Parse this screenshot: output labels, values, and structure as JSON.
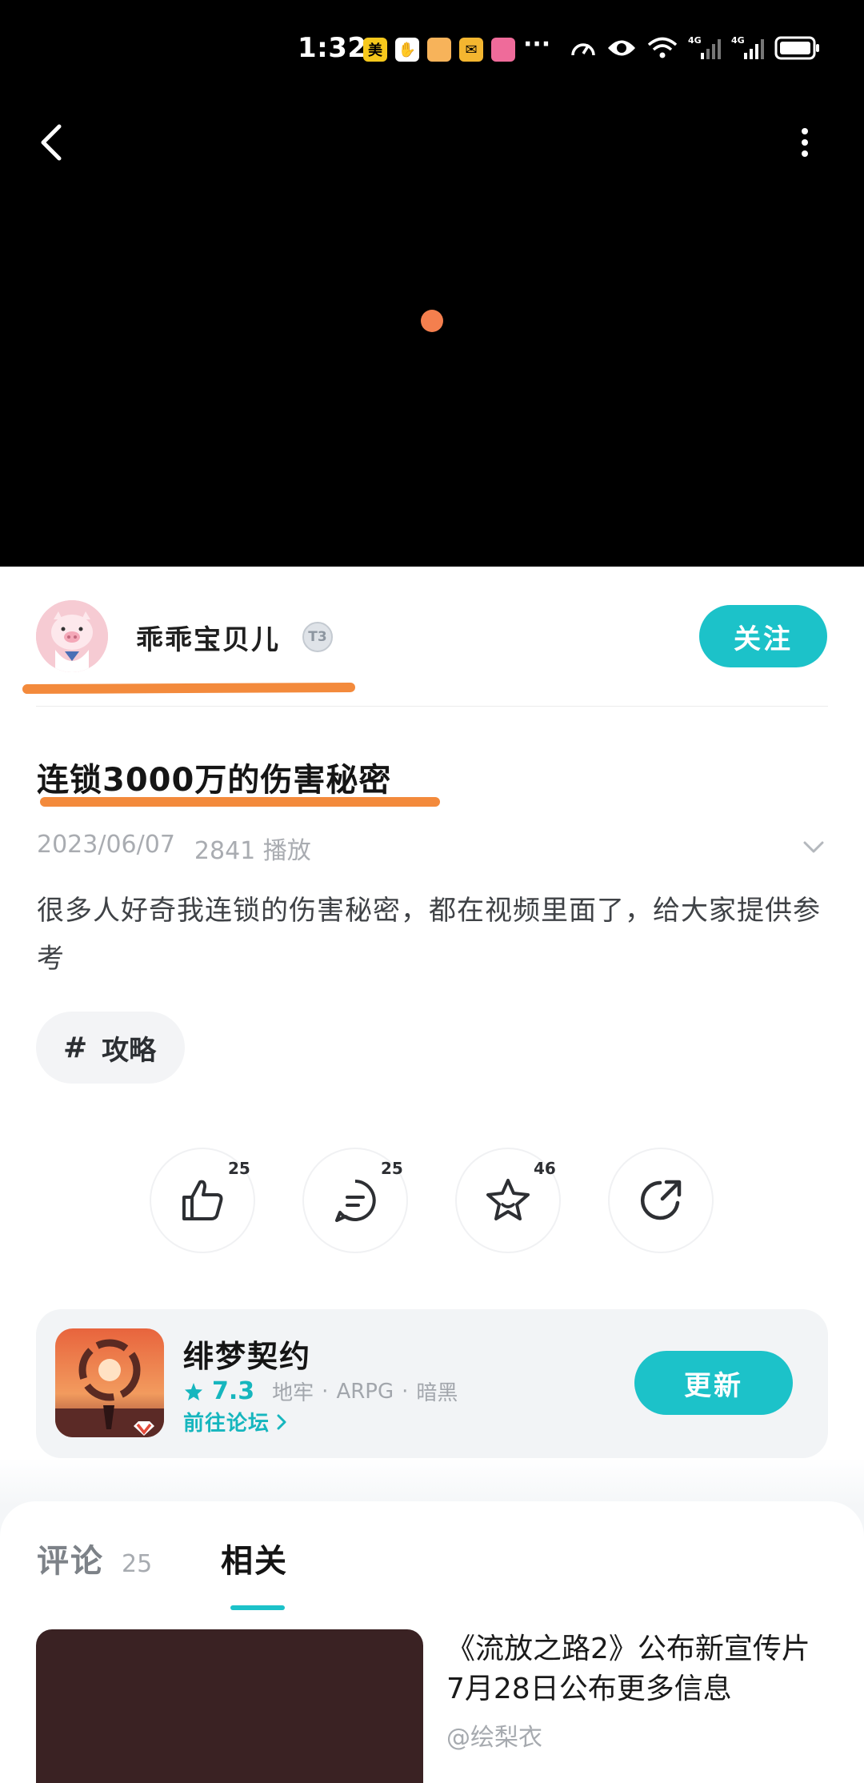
{
  "status_bar": {
    "time": "1:32",
    "app_icons": [
      {
        "icon": "meituan-icon",
        "char": "美",
        "color": "#f6c81c"
      },
      {
        "icon": "hand-icon",
        "char": "✋",
        "color": "#ffffff"
      },
      {
        "icon": "app-orange-icon",
        "char": "",
        "color": "#f7b35a"
      },
      {
        "icon": "mail-icon",
        "char": "✉",
        "color": "#f4b630"
      },
      {
        "icon": "app-pink-icon",
        "char": "",
        "color": "#ef6b9a"
      }
    ],
    "more": "···",
    "network_labels": [
      "4G",
      "4G"
    ]
  },
  "player": {
    "back_icon": "back-arrow-icon",
    "more_icon": "more-vertical-icon",
    "loading_color": "#f47f4e"
  },
  "author": {
    "name": "乖乖宝贝儿",
    "level": "T3",
    "follow_label": "关注"
  },
  "post": {
    "title": "连锁3000万的伤害秘密",
    "date": "2023/06/07",
    "plays": "2841 播放",
    "description": "很多人好奇我连锁的伤害秘密，都在视频里面了，给大家提供参考",
    "tag_hash": "#",
    "tag": "攻略"
  },
  "actions": {
    "like_count": "25",
    "comment_count": "25",
    "favorite_count": "46"
  },
  "game": {
    "name": "绯梦契约",
    "rating": "7.3",
    "genres": [
      "地牢",
      "ARPG",
      "暗黑"
    ],
    "separator": "·",
    "forum_link": "前往论坛",
    "update_label": "更新"
  },
  "tabs": {
    "comments_label": "评论",
    "comments_count": "25",
    "related_label": "相关"
  },
  "related": [
    {
      "title": "《流放之路2》公布新宣传片 7月28日公布更多信息",
      "author": "@绘梨衣"
    }
  ],
  "colors": {
    "accent": "#1cc2c9",
    "highlight": "#f38a3c"
  }
}
